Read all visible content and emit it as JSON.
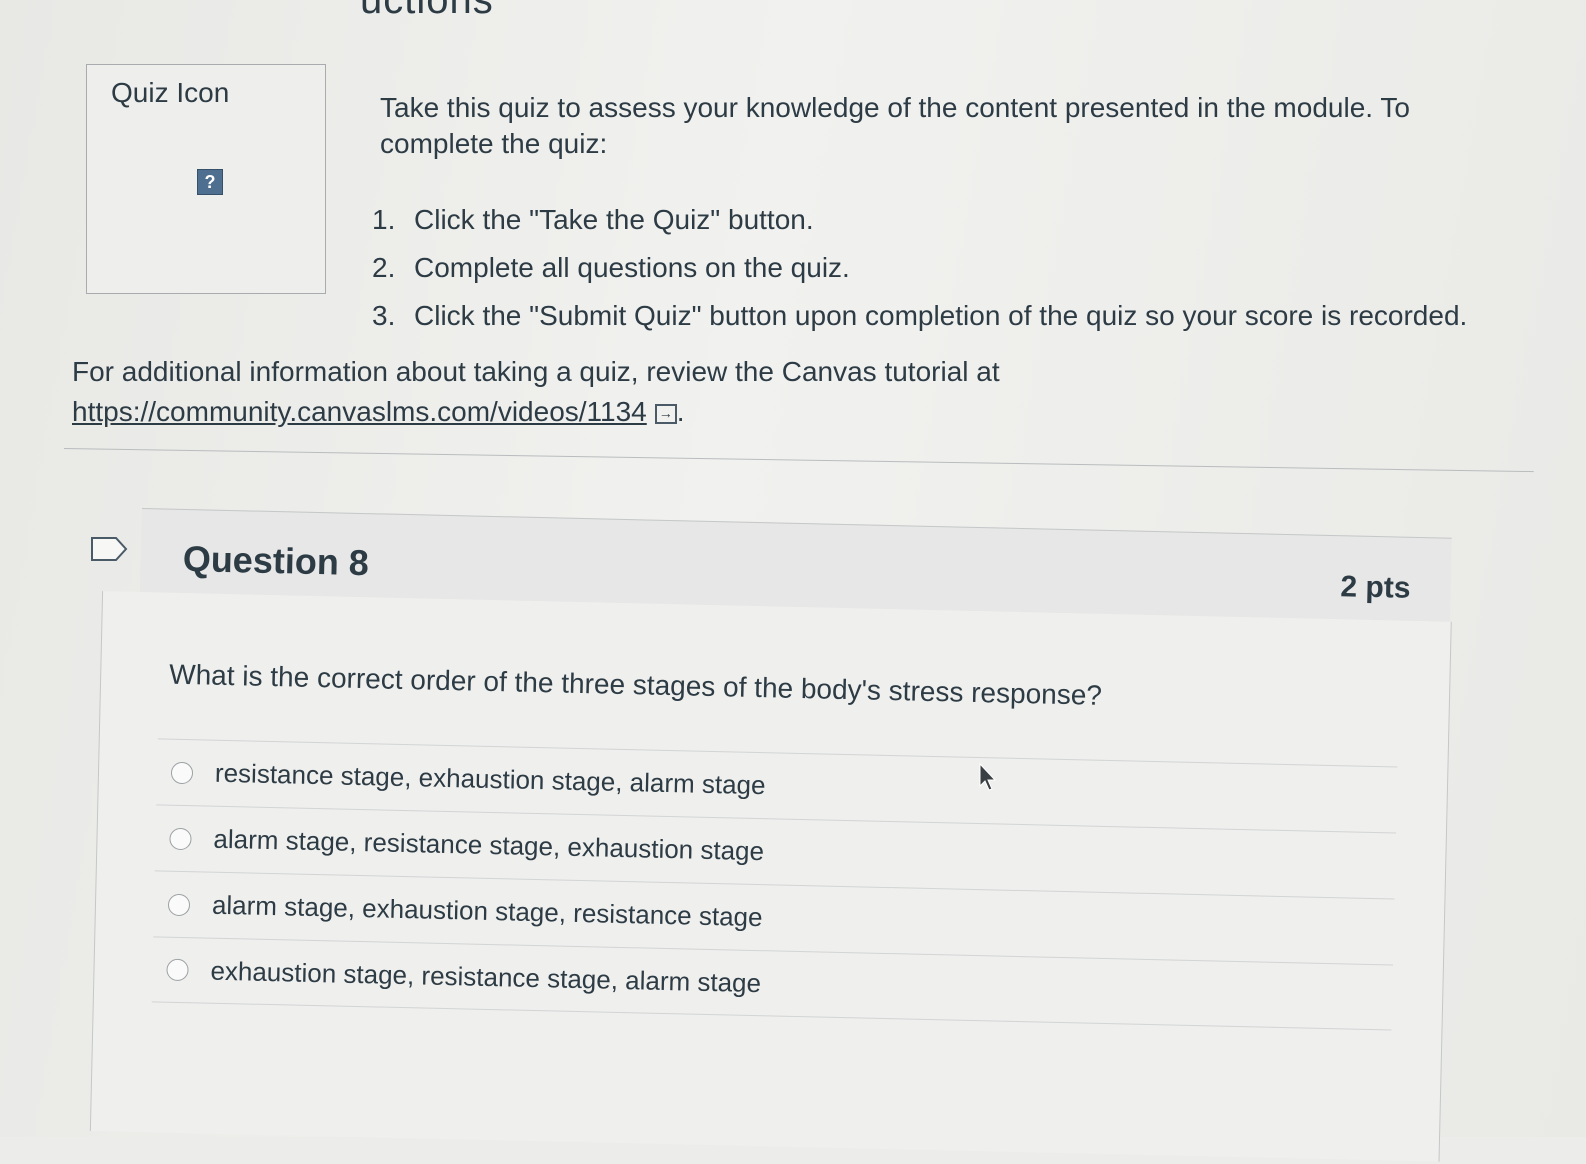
{
  "header": {
    "section_title_partial": "uctions"
  },
  "quiz_icon": {
    "label": "Quiz Icon",
    "glyph": "?"
  },
  "intro": {
    "line1": "Take this quiz to assess your knowledge of the content presented in the module.  To complete the quiz:",
    "steps": [
      {
        "num": "1.",
        "text": "Click the \"Take the Quiz\" button."
      },
      {
        "num": "2.",
        "text": "Complete all questions on the quiz."
      },
      {
        "num": "3.",
        "text": "Click the \"Submit Quiz\" button upon completion of the quiz so your score is recorded."
      }
    ]
  },
  "additional": {
    "text": "For additional information about taking a quiz, review the Canvas tutorial at ",
    "link": "https://community.canvaslms.com/videos/1134",
    "suffix": "."
  },
  "question": {
    "title": "Question 8",
    "points": "2 pts",
    "text": "What is the correct order of  the three stages of the body's stress response?",
    "answers": [
      "resistance stage, exhaustion stage, alarm stage",
      "alarm stage, resistance stage, exhaustion stage",
      "alarm stage, exhaustion stage, resistance stage",
      "exhaustion stage, resistance stage, alarm stage"
    ]
  },
  "icons": {
    "flag": "flag-icon",
    "external_link": "external-link-icon",
    "cursor": "mouse-pointer-icon"
  }
}
